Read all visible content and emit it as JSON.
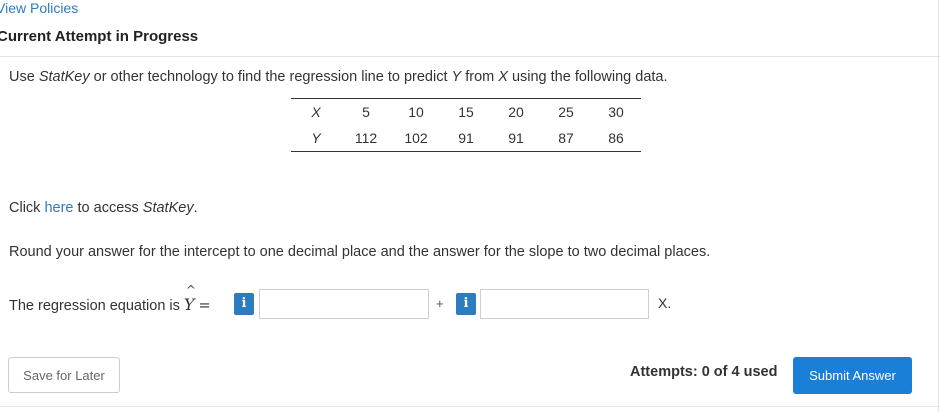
{
  "header": {
    "view_policies": "View Policies",
    "attempt_title": "Current Attempt in Progress"
  },
  "question": {
    "prefix": "Use ",
    "statkey": "StatKey",
    "middle": " or other technology to find the regression line to predict ",
    "y_var": "Y",
    "from": " from ",
    "x_var": "X",
    "suffix": " using the following data."
  },
  "data_table": {
    "rows": [
      {
        "label": "X",
        "values": [
          "5",
          "10",
          "15",
          "20",
          "25",
          "30"
        ]
      },
      {
        "label": "Y",
        "values": [
          "112",
          "102",
          "91",
          "91",
          "87",
          "86"
        ]
      }
    ]
  },
  "click_line": {
    "prefix": "Click ",
    "link": "here",
    "middle": " to access ",
    "statkey": "StatKey",
    "suffix": "."
  },
  "round_instruction": "Round your answer for the intercept to one decimal place and the answer for the slope to two decimal places.",
  "equation": {
    "prefix": "The regression equation is ",
    "y_symbol": "Y",
    "hat": "^",
    "equals": "=",
    "plus": "+",
    "x_suffix": "X.",
    "info_label": "i",
    "intercept_value": "",
    "slope_value": ""
  },
  "footer": {
    "save_label": "Save for Later",
    "attempts": "Attempts: 0 of 4 used",
    "submit_label": "Submit Answer"
  },
  "colors": {
    "link": "#2c7dc0",
    "submit_bg": "#1a7fd6",
    "info_bg": "#2c7dc0"
  }
}
